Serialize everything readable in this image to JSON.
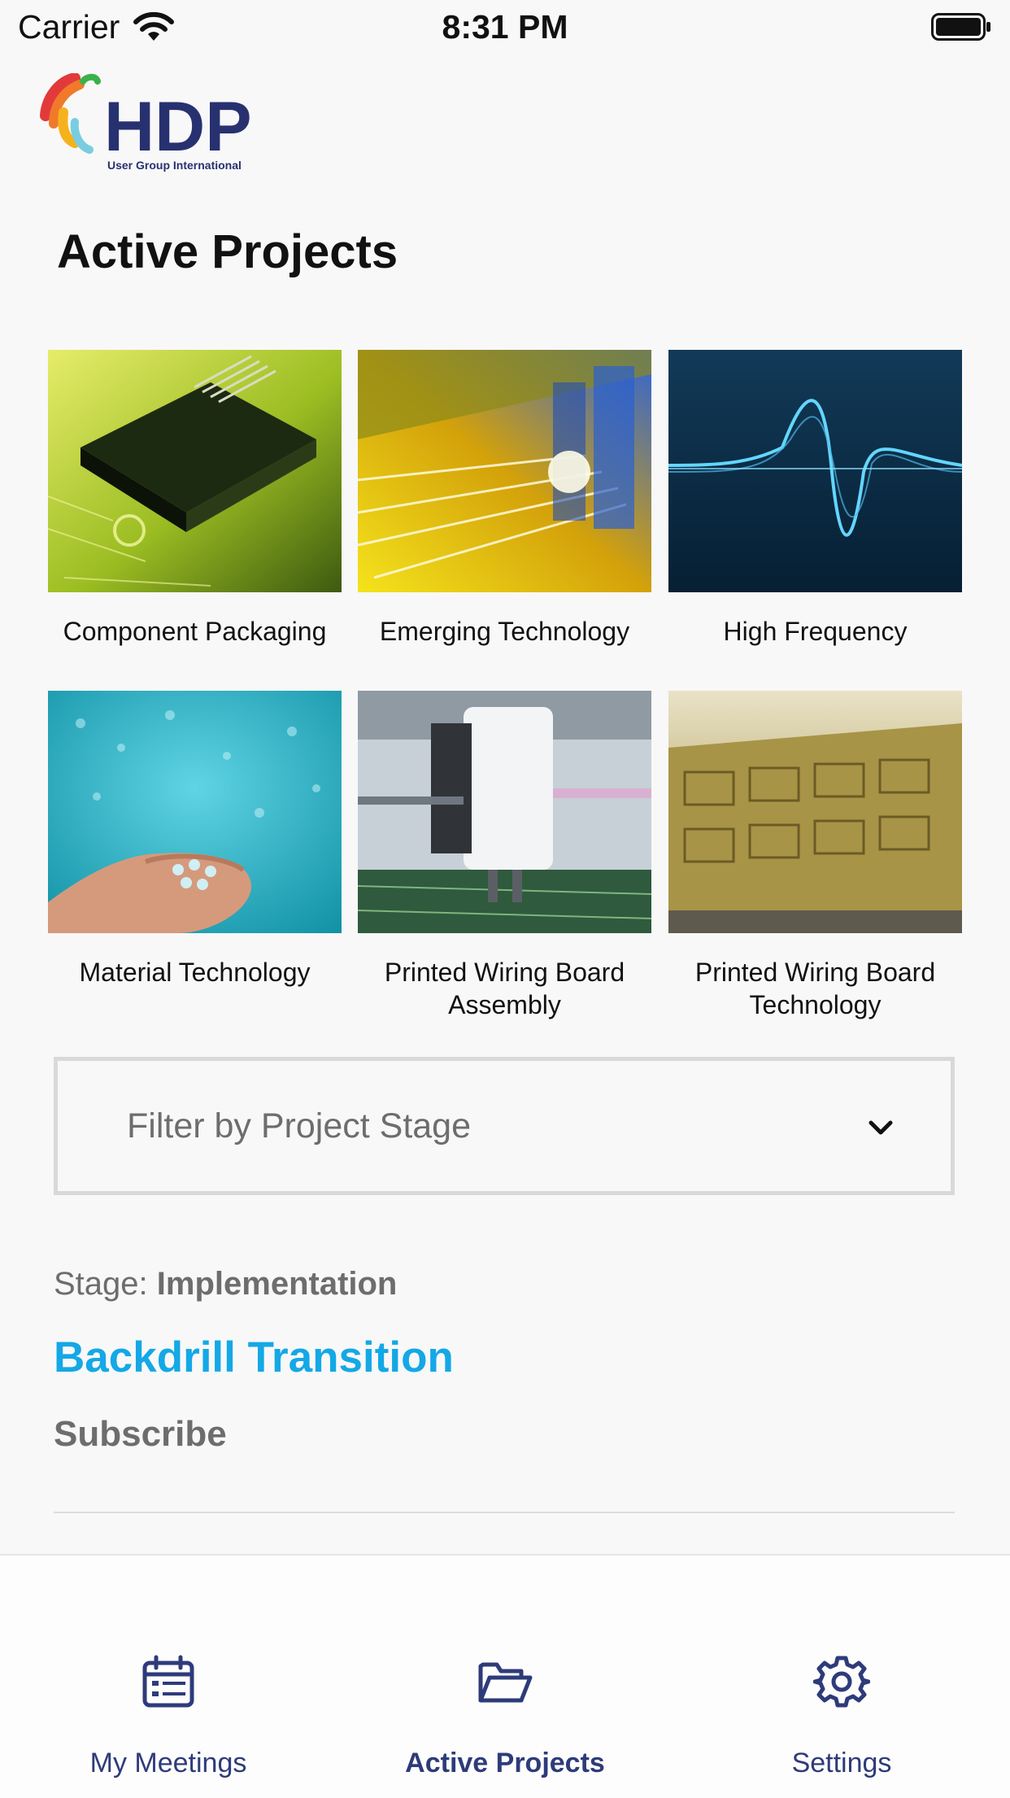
{
  "status_bar": {
    "carrier": "Carrier",
    "time": "8:31 PM"
  },
  "logo": {
    "letters": "HDP",
    "tagline": "User Group International"
  },
  "page_title": "Active Projects",
  "projects": [
    {
      "label": "Component Packaging",
      "image": "chip-photo"
    },
    {
      "label": "Emerging Technology",
      "image": "light-speed-photo"
    },
    {
      "label": "High Frequency",
      "image": "wave-photo"
    },
    {
      "label": "Material Technology",
      "image": "granules-photo"
    },
    {
      "label": "Printed Wiring Board Assembly",
      "image": "assembly-machine-photo"
    },
    {
      "label": "Printed Wiring Board Technology",
      "image": "pcb-panel-photo"
    }
  ],
  "filter": {
    "placeholder": "Filter by Project Stage"
  },
  "stage": {
    "prefix": "Stage:",
    "value": "Implementation"
  },
  "project_link": "Backdrill Transition",
  "subscribe_label": "Subscribe",
  "tabs": [
    {
      "label": "My Meetings",
      "icon": "calendar-icon",
      "active": false
    },
    {
      "label": "Active Projects",
      "icon": "folder-icon",
      "active": true
    },
    {
      "label": "Settings",
      "icon": "gear-icon",
      "active": false
    }
  ],
  "colors": {
    "accent": "#14a8e6",
    "tab_tint": "#2e3b7a",
    "muted_text": "#6d6d6d",
    "background": "#f8f8f8"
  }
}
